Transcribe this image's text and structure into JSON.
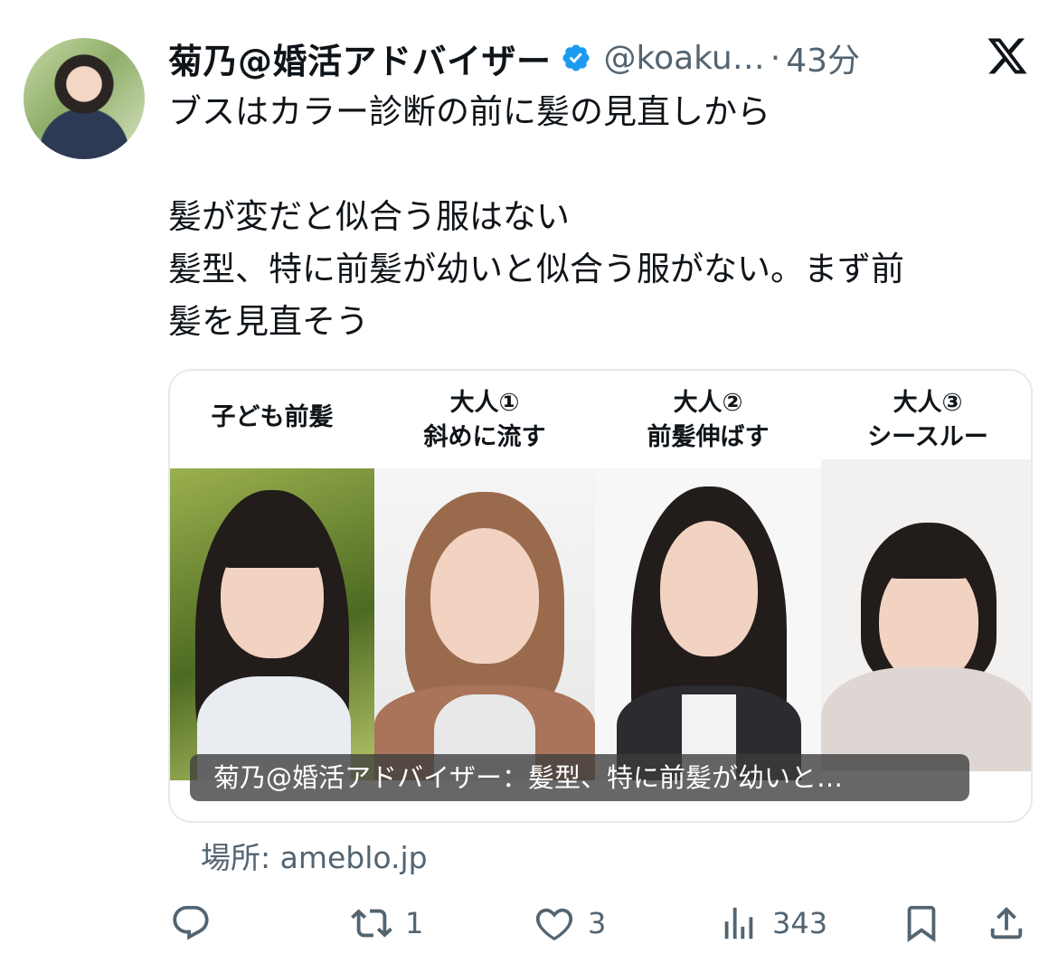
{
  "tweet": {
    "display_name": "菊乃@婚活アドバイザー",
    "handle": "@koaku…",
    "separator": "·",
    "time": "43分",
    "text_lines": [
      "ブスはカラー診断の前に髪の見直しから",
      "髪が変だと似合う服はない",
      "髪型、特に前髪が幼いと似合う服がない。まず前",
      "髪を見直そう"
    ]
  },
  "card": {
    "columns": [
      {
        "line1": "子ども前髪",
        "line2": ""
      },
      {
        "line1": "大人①",
        "line2": "斜めに流す"
      },
      {
        "line1": "大人②",
        "line2": "前髪伸ばす"
      },
      {
        "line1": "大人③",
        "line2": "シースルー"
      }
    ],
    "caption": "菊乃@婚活アドバイザー：髪型、特に前髪が幼いと…"
  },
  "source": "場所: ameblo.jp",
  "actions": {
    "reply_count": "",
    "retweet_count": "1",
    "like_count": "3",
    "views_count": "343"
  },
  "colors": {
    "verified": "#1d9bf0",
    "muted": "#536471",
    "text": "#0f1419"
  },
  "icons": [
    "verified-badge-icon",
    "x-logo-icon",
    "reply-icon",
    "retweet-icon",
    "like-icon",
    "views-icon",
    "bookmark-icon",
    "share-icon"
  ]
}
